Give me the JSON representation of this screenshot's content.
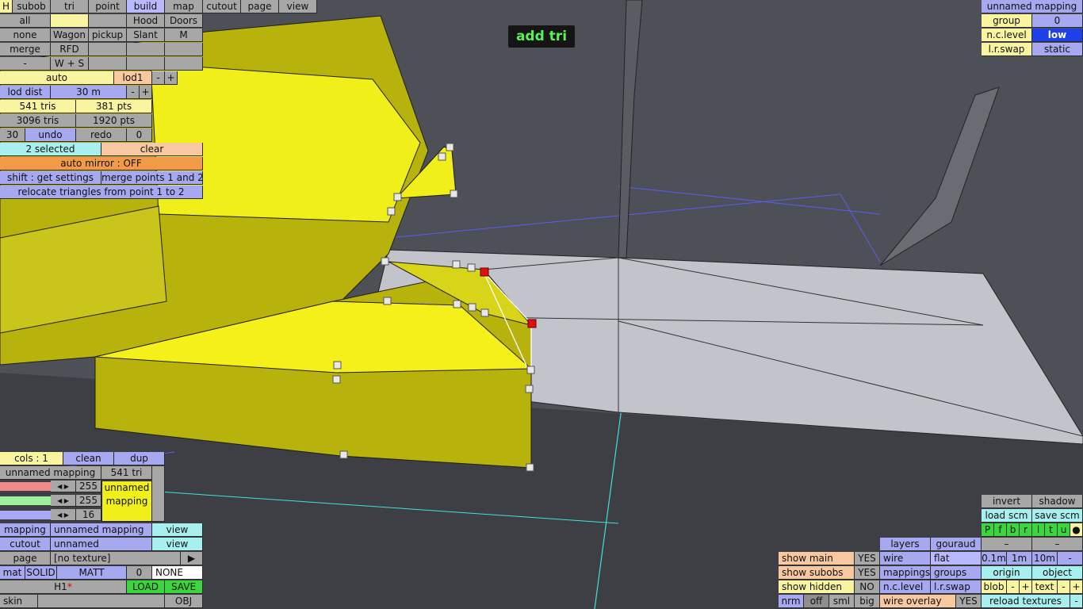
{
  "toast": "add tri",
  "top_row": [
    "H",
    "subob",
    "tri",
    "point",
    "build",
    "map",
    "cutout",
    "page",
    "view"
  ],
  "row2": [
    "all",
    "",
    "Hood",
    "Doors"
  ],
  "row3": [
    "none",
    "Wagon",
    "pickup",
    "Slant",
    "M"
  ],
  "row4": [
    "merge",
    "RFD"
  ],
  "row5": [
    "-",
    "W + S"
  ],
  "lod": {
    "auto": "auto",
    "lod": "lod1",
    "minus": "-",
    "plus": "+",
    "dist_label": "lod dist",
    "dist_value": "30 m"
  },
  "stats": {
    "tris1": "541 tris",
    "pts1": "381 pts",
    "tris2": "3096 tris",
    "pts2": "1920 pts"
  },
  "undo_row": {
    "count": "30",
    "undo": "undo",
    "redo": "redo",
    "redo_count": "0"
  },
  "selection": {
    "selected": "2 selected",
    "clear": "clear",
    "mirror": "auto mirror : OFF",
    "shift": "shift : get settings",
    "merge": "merge points 1 and 2",
    "relocate": "relocate triangles from point 1 to 2"
  },
  "top_right": {
    "mapping": "unnamed mapping",
    "group": "group",
    "group_val": "0",
    "nclevel": "n.c.level",
    "nclevel_val": "low",
    "lrswap": "l.r.swap",
    "lrswap_val": "static"
  },
  "bottom_left": {
    "cols": "cols : 1",
    "clean": "clean",
    "dup": "dup",
    "mapping": "unnamed mapping",
    "tri": "541 tri",
    "val1": "255",
    "val2": "255",
    "val3": "16",
    "preview": "unnamed mapping",
    "mapping_label": "mapping",
    "mapping_val": "unnamed mapping",
    "view": "view",
    "cutout_label": "cutout",
    "cutout_val": "unnamed",
    "view2": "view",
    "page_label": "page",
    "page_val": "[no texture]",
    "page_arrow": "▶",
    "mat": "mat",
    "solid": "SOLID",
    "matt": "MATT",
    "zero": "0",
    "none": "NONE",
    "h1": "H1",
    "star": "*",
    "load": "LOAD",
    "save": "SAVE",
    "skin": "skin",
    "obj": "OBJ"
  },
  "bottom_right": {
    "invert": "invert",
    "shadow": "shadow",
    "loadscm": "load scm",
    "savescm": "save scm",
    "flags": [
      "P",
      "f",
      "b",
      "r",
      "l",
      "t",
      "u",
      "●"
    ],
    "layers": "layers",
    "gouraud": "gouraud",
    "wire": "wire",
    "flat": "flat",
    "mappings": "mappings",
    "groups": "groups",
    "nclevel": "n.c.level",
    "lrswap": "l.r.swap",
    "wireoverlay": "wire overlay",
    "wireoverlay_val": "YES",
    "showmain": "show main",
    "showmain_val": "YES",
    "showsubobs": "show subobs",
    "showsubobs_val": "YES",
    "showhidden": "show hidden",
    "showhidden_val": "NO",
    "nrm": "nrm",
    "off": "off",
    "sml": "sml",
    "big": "big",
    "d1": "0.1m",
    "d2": "1m",
    "d3": "10m",
    "dm": "-",
    "origin": "origin",
    "object": "object",
    "blob": "blob",
    "text": "text",
    "m": "-",
    "p": "+",
    "reload": "reload textures",
    "dash": "–"
  },
  "colors": {
    "model": "#f0ef19",
    "model_dark": "#b8b30c",
    "ground": "#c3c3cc",
    "bg": "#4e5058"
  }
}
